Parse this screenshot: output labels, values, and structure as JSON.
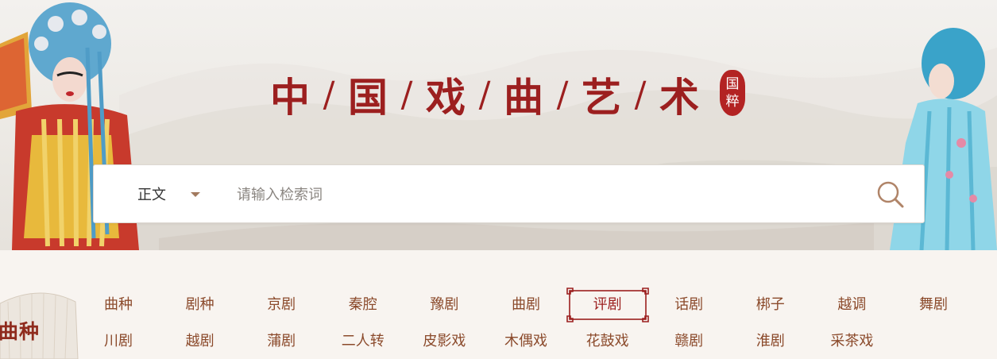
{
  "banner": {
    "title_chars": [
      "中",
      "国",
      "戏",
      "曲",
      "艺",
      "术"
    ],
    "separator": "/",
    "seal_chars": [
      "国",
      "粹"
    ]
  },
  "search": {
    "scope_label": "正文",
    "placeholder": "请输入检索词"
  },
  "categories": {
    "badge_label": "曲种",
    "row1": [
      "曲种",
      "剧种",
      "京剧",
      "秦腔",
      "豫剧",
      "曲剧",
      "评剧",
      "话剧",
      "梆子",
      "越调",
      "舞剧"
    ],
    "row2": [
      "川剧",
      "越剧",
      "蒲剧",
      "二人转",
      "皮影戏",
      "木偶戏",
      "花鼓戏",
      "赣剧",
      "淮剧",
      "采茶戏"
    ],
    "active": "评剧"
  },
  "colors": {
    "brand_red": "#9c1f1f",
    "link_brown": "#8b4a2b",
    "accent_tan": "#a27a5e"
  }
}
